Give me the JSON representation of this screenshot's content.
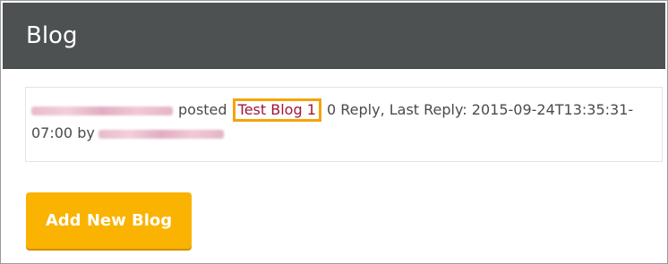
{
  "panel": {
    "title": "Blog"
  },
  "post": {
    "author": "",
    "verb": "posted",
    "blog_title": "Test Blog 1",
    "meta": "0 Reply, Last Reply: 2015-09-24T13:35:31-07:00 by",
    "last_replier": ""
  },
  "actions": {
    "add_new_blog": "Add New Blog"
  },
  "colors": {
    "header_bg": "#4d5152",
    "link": "#a1153a",
    "highlight_border": "#f5a30a",
    "button_bg": "#f9b300"
  }
}
